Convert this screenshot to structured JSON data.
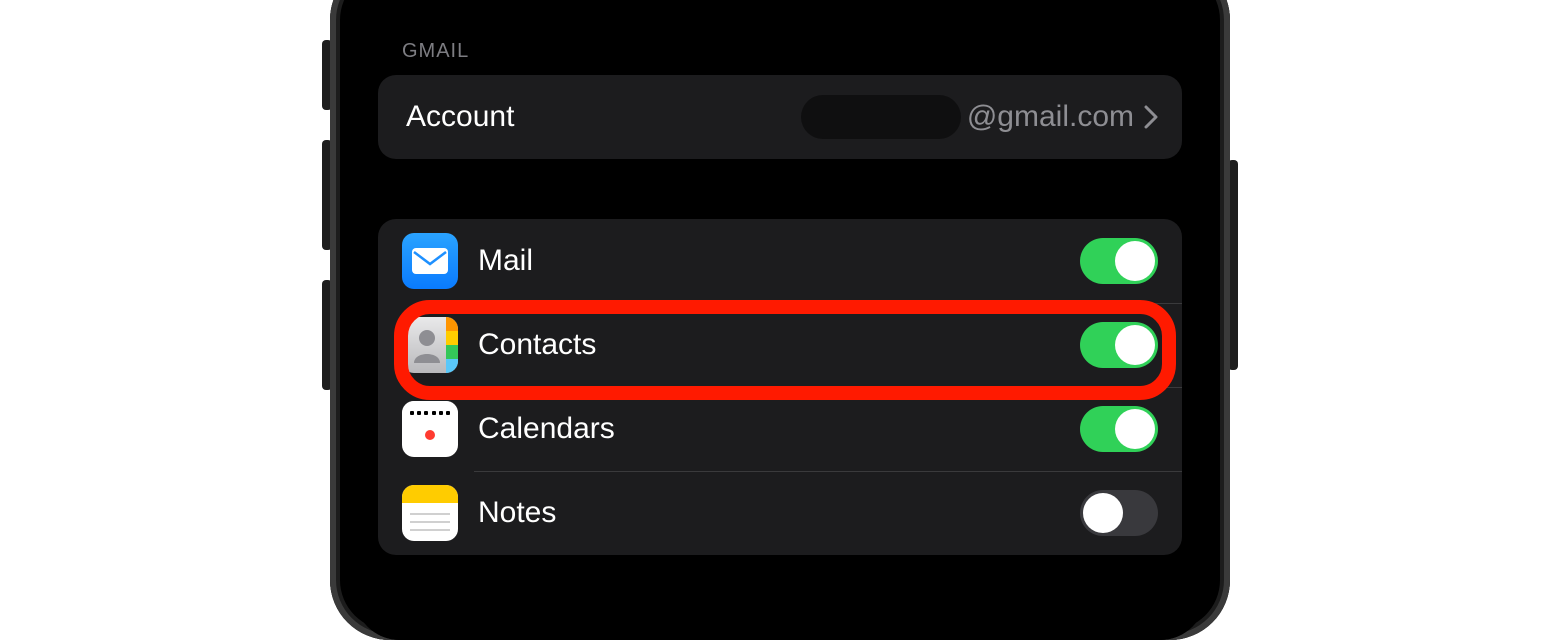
{
  "section_header": "GMAIL",
  "account": {
    "label": "Account",
    "value_suffix": "@gmail.com"
  },
  "services": [
    {
      "icon": "mail-icon",
      "label": "Mail",
      "enabled": true
    },
    {
      "icon": "contacts-icon",
      "label": "Contacts",
      "enabled": true
    },
    {
      "icon": "calendar-icon",
      "label": "Calendars",
      "enabled": true
    },
    {
      "icon": "notes-icon",
      "label": "Notes",
      "enabled": false
    }
  ],
  "highlight_index": 1
}
